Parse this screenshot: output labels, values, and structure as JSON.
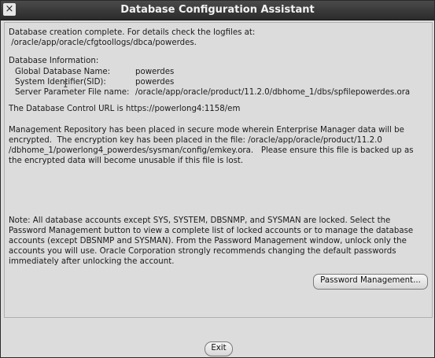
{
  "window": {
    "title": "Database Configuration Assistant",
    "close_glyph": "×"
  },
  "summary": {
    "line1": "Database creation complete. For details check the logfiles at:",
    "line2": " /oracle/app/oracle/cfgtoollogs/dbca/powerdes."
  },
  "db_info": {
    "heading": "Database Information:",
    "rows": [
      {
        "label": "Global Database Name:",
        "value": "powerdes"
      },
      {
        "label": "System Identifier(SID):",
        "value": "powerdes"
      },
      {
        "label": "Server Parameter File name:",
        "value": "/oracle/app/oracle/product/11.2.0/dbhome_1/dbs/spfilepowerdes.ora"
      }
    ]
  },
  "dbcontrol": {
    "text": "The Database Control URL is https://powerlong4:1158/em"
  },
  "repository": {
    "lines": [
      "Management Repository has been placed in secure mode wherein Enterprise Manager data will be",
      "encrypted.  The encryption key has been placed in the file: /oracle/app/oracle/product/11.2.0",
      "/dbhome_1/powerlong4_powerdes/sysman/config/emkey.ora.   Please ensure this file is backed up as",
      "the encrypted data will become unusable if this file is lost."
    ]
  },
  "note": {
    "lines": [
      "Note: All database accounts except SYS, SYSTEM, DBSNMP, and SYSMAN are locked. Select the",
      "Password Management button to view a complete list of locked accounts or to manage the database",
      "accounts (except DBSNMP and SYSMAN). From the Password Management window, unlock only the",
      "accounts you will use. Oracle Corporation strongly recommends changing the default passwords",
      "immediately after unlocking the account."
    ]
  },
  "buttons": {
    "password_management": "Password Management...",
    "exit": "Exit"
  },
  "cursor_glyph": "I"
}
